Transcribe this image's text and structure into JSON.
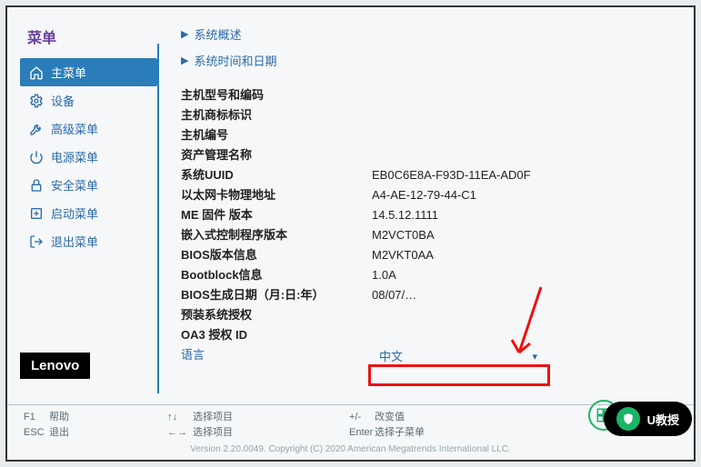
{
  "sidebar": {
    "title": "菜单",
    "items": [
      {
        "label": "主菜单"
      },
      {
        "label": "设备"
      },
      {
        "label": "高级菜单"
      },
      {
        "label": "电源菜单"
      },
      {
        "label": "安全菜单"
      },
      {
        "label": "启动菜单"
      },
      {
        "label": "退出菜单"
      }
    ]
  },
  "brand": "Lenovo",
  "sections": {
    "overview": "系统概述",
    "datetime": "系统时间和日期"
  },
  "info": {
    "model_label": "主机型号和编码",
    "model_value": "",
    "brandid_label": "主机商标标识",
    "brandid_value": "",
    "serial_label": "主机编号",
    "serial_value": "",
    "asset_label": "资产管理名称",
    "asset_value": "",
    "uuid_label": "系统UUID",
    "uuid_value": "EB0C6E8A-F93D-11EA-AD0F",
    "mac_label": "以太网卡物理地址",
    "mac_value": "A4-AE-12-79-44-C1",
    "me_label": "ME 固件 版本",
    "me_value": "14.5.12.1111",
    "ec_label": "嵌入式控制程序版本",
    "ec_value": "M2VCT0BA",
    "bios_label": "BIOS版本信息",
    "bios_value": "M2VKT0AA",
    "boot_label": "Bootblock信息",
    "boot_value": "1.0A",
    "build_label": "BIOS生成日期（月:日:年）",
    "build_value": "08/07/…",
    "preload_label": "预装系统授权",
    "preload_value": "",
    "oa3_label": "OA3 授权 ID",
    "oa3_value": "",
    "lang_label": "语言",
    "lang_value": "中文"
  },
  "footer": {
    "f1": "F1",
    "help": "帮助",
    "esc": "ESC",
    "exit": "退出",
    "selectItem": "选择项目",
    "changeValue": "改变值",
    "selectSub": "选择子菜单",
    "enter": "Enter",
    "plusminus": "+/-"
  },
  "copyright": "Version 2.20.0049. Copyright (C) 2020 American Megatrends International LLC.",
  "badge": "U教授"
}
